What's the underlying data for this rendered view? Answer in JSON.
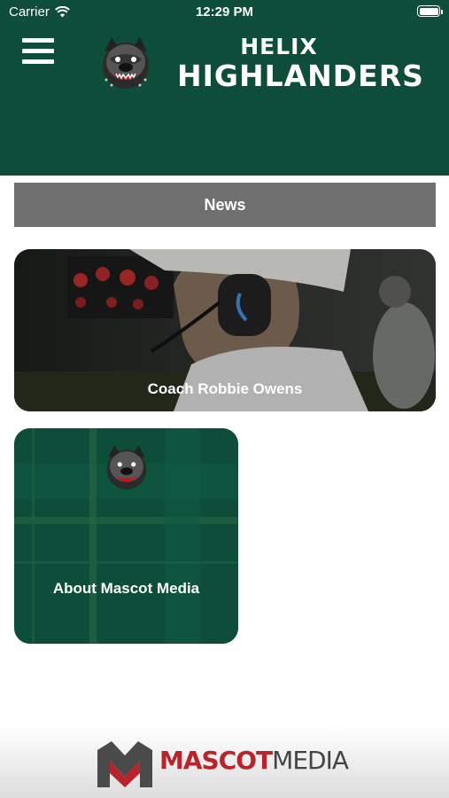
{
  "status_bar": {
    "carrier": "Carrier",
    "time": "12:29 PM"
  },
  "header": {
    "brand_line1": "HELIX",
    "brand_line2": "HIGHLANDERS",
    "bg_color": "#0d4d39"
  },
  "news_bar": {
    "label": "News"
  },
  "cards": [
    {
      "label": "Coach Robbie Owens",
      "image": "coach-photo"
    },
    {
      "label": "About Mascot Media",
      "image": "bulldog-logo-on-plaid"
    }
  ],
  "footer": {
    "brand_part1": "MASCOT",
    "brand_part2": "MEDIA"
  },
  "icons": [
    "wifi-icon",
    "battery-icon",
    "menu-icon",
    "bulldog-logo",
    "mascot-media-m-logo"
  ]
}
